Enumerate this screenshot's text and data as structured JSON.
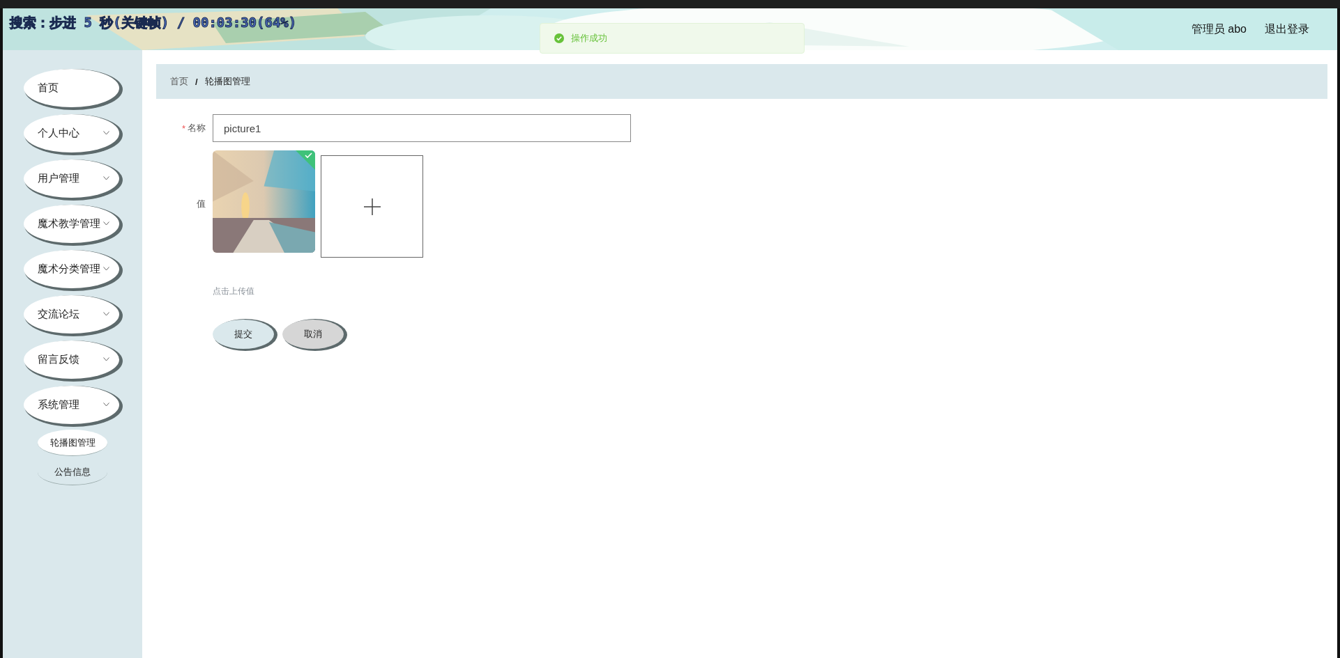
{
  "video_overlay": {
    "text": "搜索：步进 5 秒(关键帧) / 00:03:30(64%)"
  },
  "header": {
    "user": "管理员 abo",
    "logout": "退出登录"
  },
  "toast": {
    "message": "操作成功"
  },
  "sidebar": {
    "items": [
      {
        "label": "首页",
        "kind": "link"
      },
      {
        "label": "个人中心",
        "kind": "submenu"
      },
      {
        "label": "用户管理",
        "kind": "submenu"
      },
      {
        "label": "魔术教学管理",
        "kind": "submenu"
      },
      {
        "label": "魔术分类管理",
        "kind": "submenu"
      },
      {
        "label": "交流论坛",
        "kind": "submenu"
      },
      {
        "label": "留言反馈",
        "kind": "submenu"
      },
      {
        "label": "系统管理",
        "kind": "submenu",
        "children": [
          {
            "label": "轮播图管理",
            "selected": true
          },
          {
            "label": "公告信息",
            "selected": false
          }
        ]
      }
    ]
  },
  "breadcrumb": {
    "items": [
      "首页",
      "轮播图管理"
    ],
    "separator": "/"
  },
  "form": {
    "fields": [
      {
        "kind": "text",
        "label": "名称",
        "required": true,
        "required_mark": "*",
        "value": "picture1"
      },
      {
        "label": "值",
        "required": false,
        "images": [
          {
            "kind": "picture",
            "uploaded": true
          }
        ],
        "hint": "点击上传值"
      }
    ],
    "buttons": [
      {
        "label": "提交",
        "kind": "primary"
      },
      {
        "label": "取消",
        "kind": "cancel"
      }
    ]
  }
}
